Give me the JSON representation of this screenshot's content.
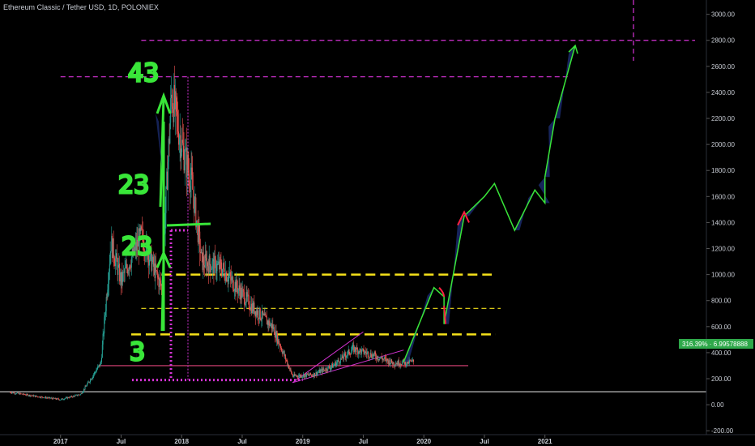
{
  "header": {
    "title": "Ethereum Classic / Tether USD, 1D, POLONIEX"
  },
  "price_badge": {
    "text": "316.39% · 6.99578888"
  },
  "annotations": {
    "labels": [
      "43",
      "23",
      "23",
      "3"
    ]
  },
  "colors": {
    "background": "#000000",
    "up_candle": "#26a69a",
    "down_candle": "#ef5350",
    "magenta": "#d633d6",
    "yellow": "#f5e11a",
    "green_annotation": "#39e639",
    "projection_fill": "#1a2a6b",
    "badge": "#2ea84a"
  },
  "chart_data": {
    "type": "candlestick",
    "title": "Ethereum Classic / Tether USD, 1D, POLONIEX",
    "y_ticks": [
      -200,
      0,
      200,
      400,
      600,
      800,
      1000,
      1200,
      1400,
      1600,
      1800,
      2000,
      2200,
      2400,
      2600,
      2800,
      3000
    ],
    "y_tick_labels": [
      "-200.00",
      "0.00",
      "200.00",
      "400.00",
      "600.00",
      "800.00",
      "1000.00",
      "1200.00",
      "1400.00",
      "1600.00",
      "1800.00",
      "2000.00",
      "2200.00",
      "2400.00",
      "2600.00",
      "2800.00",
      "3000.00"
    ],
    "ylim": [
      -230,
      3110
    ],
    "x_ticks": [
      "2017",
      "Jul",
      "2018",
      "Jul",
      "2019",
      "Jul",
      "2020",
      "Jul",
      "2021"
    ],
    "x_tick_dates": [
      "2017-01",
      "2017-07",
      "2018-01",
      "2018-07",
      "2019-01",
      "2019-07",
      "2020-01",
      "2020-07",
      "2021-01"
    ],
    "xlim": [
      "2016-07",
      "2022-05"
    ],
    "price_path": [
      {
        "date": "2016-08",
        "price": 95
      },
      {
        "date": "2016-11",
        "price": 60
      },
      {
        "date": "2017-01",
        "price": 40
      },
      {
        "date": "2017-03",
        "price": 80
      },
      {
        "date": "2017-05",
        "price": 320
      },
      {
        "date": "2017-06",
        "price": 1250
      },
      {
        "date": "2017-07",
        "price": 950
      },
      {
        "date": "2017-09",
        "price": 1300
      },
      {
        "date": "2017-11",
        "price": 900
      },
      {
        "date": "2017-12",
        "price": 2400
      },
      {
        "date": "2018-01",
        "price": 2000
      },
      {
        "date": "2018-02",
        "price": 1700
      },
      {
        "date": "2018-03",
        "price": 1100
      },
      {
        "date": "2018-05",
        "price": 1050
      },
      {
        "date": "2018-06",
        "price": 950
      },
      {
        "date": "2018-08",
        "price": 750
      },
      {
        "date": "2018-10",
        "price": 600
      },
      {
        "date": "2018-12",
        "price": 220
      },
      {
        "date": "2019-02",
        "price": 230
      },
      {
        "date": "2019-04",
        "price": 300
      },
      {
        "date": "2019-06",
        "price": 430
      },
      {
        "date": "2019-08",
        "price": 380
      },
      {
        "date": "2019-10",
        "price": 320
      },
      {
        "date": "2019-12",
        "price": 330
      }
    ],
    "horizontal_levels": [
      {
        "price": 2800,
        "color": "magenta",
        "style": "dashed"
      },
      {
        "price": 2520,
        "color": "magenta",
        "style": "dashed"
      },
      {
        "price": 1000,
        "color": "yellow",
        "style": "dashed"
      },
      {
        "price": 740,
        "color": "yellow",
        "style": "dashed"
      },
      {
        "price": 540,
        "color": "yellow",
        "style": "dashed"
      },
      {
        "price": 300,
        "color": "pink",
        "style": "solid"
      },
      {
        "price": 190,
        "color": "magenta",
        "style": "dotted"
      },
      {
        "price": 100,
        "color": "white",
        "style": "solid"
      }
    ],
    "projection_path": [
      {
        "date": "2019-11",
        "price": 330
      },
      {
        "date": "2020-02",
        "price": 900
      },
      {
        "date": "2020-03",
        "price": 830
      },
      {
        "date": "2020-03",
        "price": 620
      },
      {
        "date": "2020-05",
        "price": 1450
      },
      {
        "date": "2020-07",
        "price": 1600
      },
      {
        "date": "2020-08",
        "price": 1700
      },
      {
        "date": "2020-10",
        "price": 1340
      },
      {
        "date": "2020-12",
        "price": 1650
      },
      {
        "date": "2021-01",
        "price": 1550
      },
      {
        "date": "2021-01",
        "price": 1750
      },
      {
        "date": "2021-02",
        "price": 2200
      },
      {
        "date": "2021-04",
        "price": 2760
      }
    ],
    "current_value": 316.39
  }
}
